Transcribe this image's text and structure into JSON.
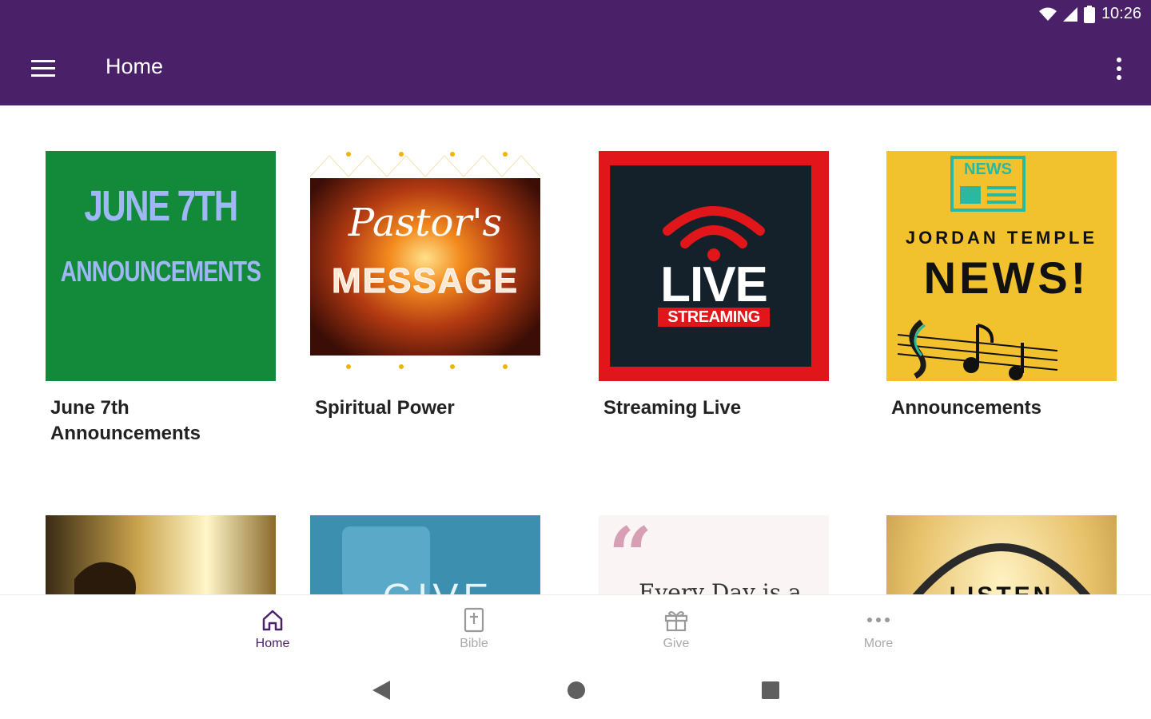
{
  "status": {
    "time": "10:26"
  },
  "app_bar": {
    "title": "Home"
  },
  "cards_row1": [
    {
      "label": "June 7th\nAnnouncements",
      "art_line1": "JUNE 7TH",
      "art_line2": "ANNOUNCEMENTS"
    },
    {
      "label": "Spiritual Power",
      "art_line1": "Pastor's",
      "art_line2": "MESSAGE"
    },
    {
      "label": "Streaming Live",
      "art_line1": "LIVE",
      "art_line2": "STREAMING"
    },
    {
      "label": "Announcements",
      "art_badge": "NEWS",
      "art_line1": "JORDAN TEMPLE",
      "art_line2": "NEWS!"
    }
  ],
  "cards_row2": [
    {
      "art_text": ""
    },
    {
      "art_text": "GIVE"
    },
    {
      "art_text": "Every Day is a"
    },
    {
      "art_text": "LISTEN"
    }
  ],
  "bottom_nav": [
    {
      "label": "Home",
      "icon": "home-icon"
    },
    {
      "label": "Bible",
      "icon": "bible-icon"
    },
    {
      "label": "Give",
      "icon": "gift-icon"
    },
    {
      "label": "More",
      "icon": "more-horiz-icon"
    }
  ],
  "colors": {
    "primary": "#4a2068",
    "green_tile": "#138a3a",
    "live_red": "#e0161b",
    "news_yellow": "#f2c12e"
  }
}
